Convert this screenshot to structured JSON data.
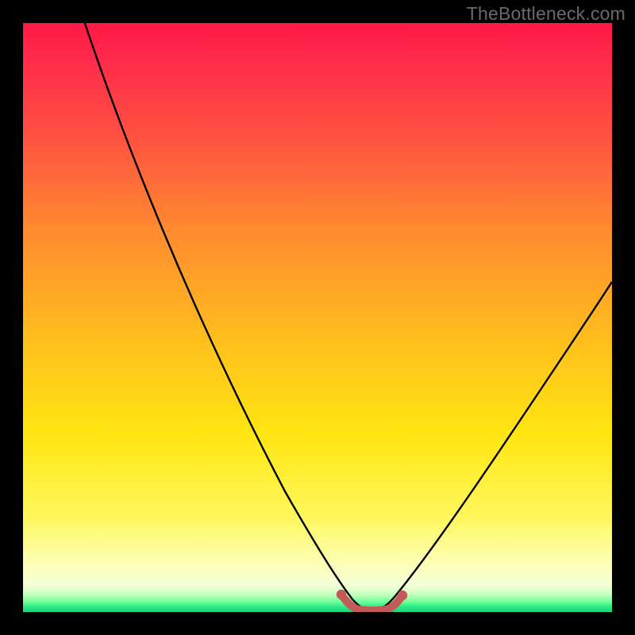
{
  "watermark": "TheBottleneck.com",
  "chart_data": {
    "type": "line",
    "title": "",
    "xlabel": "",
    "ylabel": "",
    "xlim": [
      0,
      100
    ],
    "ylim": [
      0,
      100
    ],
    "series": [
      {
        "name": "bottleneck-curve",
        "x": [
          0,
          5,
          10,
          15,
          20,
          25,
          30,
          35,
          40,
          45,
          50,
          52,
          54,
          56,
          58,
          60,
          62,
          64,
          70,
          75,
          80,
          85,
          90,
          95,
          100
        ],
        "values": [
          112,
          100,
          90,
          80,
          71,
          62,
          53,
          45,
          36,
          27,
          17,
          10,
          4,
          1,
          0,
          0,
          1,
          3,
          9,
          17,
          26,
          35,
          45,
          54,
          63
        ]
      },
      {
        "name": "optimal-band-marker",
        "x": [
          54,
          55,
          56,
          57,
          58,
          59,
          60,
          61,
          62,
          63
        ],
        "values": [
          2.3,
          1.4,
          1.0,
          0.8,
          0.8,
          0.8,
          1.0,
          1.4,
          2.0,
          2.8
        ]
      }
    ],
    "colors": {
      "curve": "#000000",
      "marker": "#c45a57",
      "gradient_top": "#ff1945",
      "gradient_bottom": "#1dd67a"
    }
  }
}
